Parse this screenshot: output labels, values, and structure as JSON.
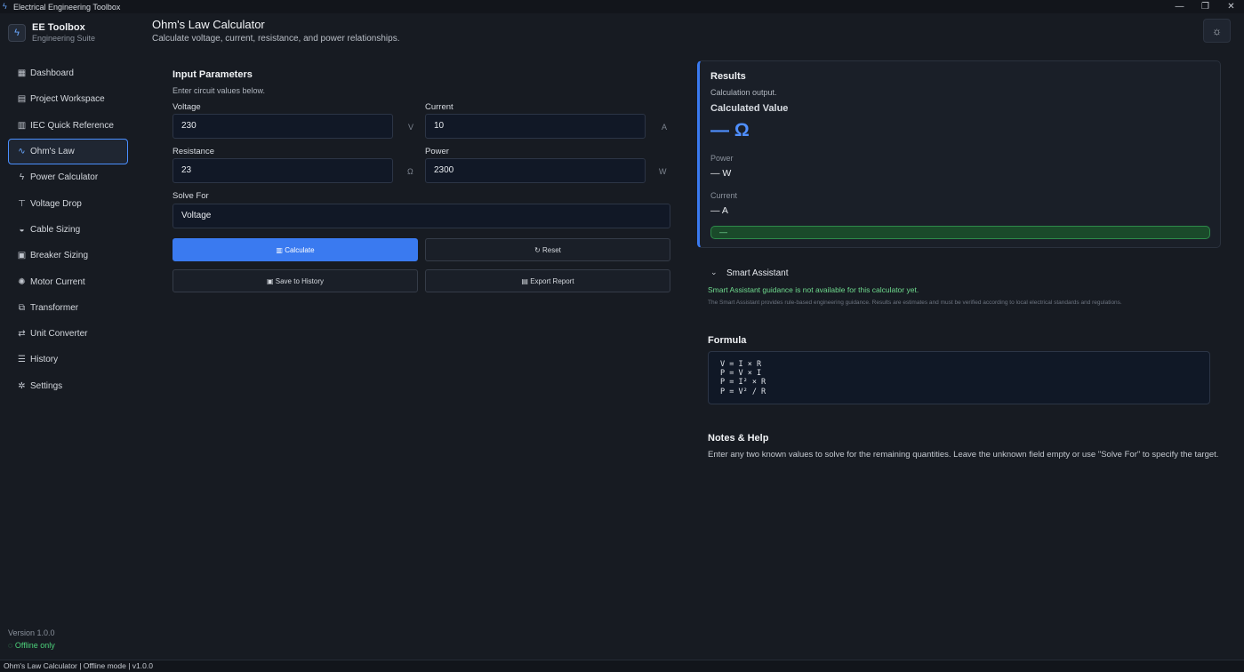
{
  "window": {
    "title": "Electrical Engineering Toolbox",
    "minimize": "—",
    "restore": "❐",
    "close": "✕"
  },
  "brand": {
    "name": "EE Toolbox",
    "subtitle": "Engineering Suite"
  },
  "sidebar": {
    "items": [
      {
        "label": "Dashboard",
        "icon": "dashboard-icon",
        "glyph": "▦"
      },
      {
        "label": "Project Workspace",
        "icon": "workspace-icon",
        "glyph": "▤"
      },
      {
        "label": "IEC Quick Reference",
        "icon": "book-icon",
        "glyph": "▥"
      },
      {
        "label": "Ohm's Law",
        "icon": "waveform-icon",
        "glyph": "∿",
        "active": true
      },
      {
        "label": "Power Calculator",
        "icon": "lightning-icon",
        "glyph": "ϟ"
      },
      {
        "label": "Voltage Drop",
        "icon": "voltage-drop-icon",
        "glyph": "⊤"
      },
      {
        "label": "Cable Sizing",
        "icon": "cable-icon",
        "glyph": "◒"
      },
      {
        "label": "Breaker Sizing",
        "icon": "breaker-icon",
        "glyph": "▣"
      },
      {
        "label": "Motor Current",
        "icon": "motor-icon",
        "glyph": "✺"
      },
      {
        "label": "Transformer",
        "icon": "transformer-icon",
        "glyph": "⧉"
      },
      {
        "label": "Unit Converter",
        "icon": "converter-icon",
        "glyph": "⇄"
      },
      {
        "label": "History",
        "icon": "history-icon",
        "glyph": "☰"
      },
      {
        "label": "Settings",
        "icon": "gear-icon",
        "glyph": "✲"
      }
    ],
    "version": "Version 1.0.0",
    "offline": "Offline only"
  },
  "header": {
    "title": "Ohm's Law Calculator",
    "subtitle": "Calculate voltage, current, resistance, and power relationships.",
    "theme_icon": "☼"
  },
  "inputs": {
    "title": "Input Parameters",
    "subtitle": "Enter circuit values below.",
    "voltage": {
      "label": "Voltage",
      "value": "230",
      "unit": "V"
    },
    "current": {
      "label": "Current",
      "value": "10",
      "unit": "A"
    },
    "resistance": {
      "label": "Resistance",
      "value": "23",
      "unit": "Ω"
    },
    "power": {
      "label": "Power",
      "value": "2300",
      "unit": "W"
    },
    "solve_for": {
      "label": "Solve For",
      "value": "Voltage"
    },
    "calculate_label": "▥ Calculate",
    "reset_label": "↻ Reset",
    "save_label": "▣ Save to History",
    "export_label": "▤ Export Report"
  },
  "results": {
    "title": "Results",
    "subtitle": "Calculation output.",
    "calc_label": "Calculated Value",
    "main_value": "— Ω",
    "power_label": "Power",
    "power_value": "— W",
    "current_label": "Current",
    "current_value": "— A",
    "status": "—"
  },
  "assistant": {
    "chevron": "⌄",
    "title": "Smart Assistant",
    "message": "Smart Assistant guidance is not available for this calculator yet.",
    "note": "The Smart Assistant provides rule-based engineering guidance. Results are estimates and must be verified according to local electrical standards and regulations."
  },
  "formula": {
    "title": "Formula",
    "lines": [
      "V = I × R",
      "P = V × I",
      "P = I² × R",
      "P = V² / R"
    ]
  },
  "notes": {
    "title": "Notes & Help",
    "text": "Enter any two known values to solve for the remaining quantities. Leave the unknown field empty or use \"Solve For\" to specify the target."
  },
  "statusbar": {
    "text": "Ohm's Law Calculator  |  Offline mode  |  v1.0.0"
  },
  "colors": {
    "accent": "#3a7af0",
    "success": "#4cd07a",
    "background": "#171b22"
  }
}
